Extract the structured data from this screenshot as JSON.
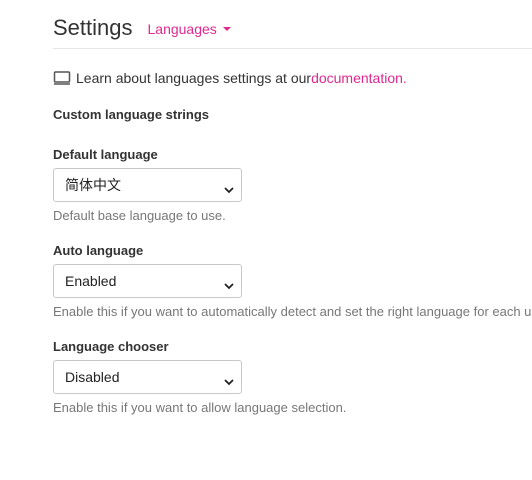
{
  "header": {
    "title": "Settings",
    "section_menu_label": "Languages"
  },
  "intro": {
    "text": "Learn about languages settings at our ",
    "link_label": "documentation",
    "suffix": "."
  },
  "section_heading": "Custom language strings",
  "fields": {
    "default_language": {
      "label": "Default language",
      "value": "简体中文",
      "help": "Default base language to use."
    },
    "auto_language": {
      "label": "Auto language",
      "value": "Enabled",
      "help": "Enable this if you want to automatically detect and set the right language for each u"
    },
    "language_chooser": {
      "label": "Language chooser",
      "value": "Disabled",
      "help": "Enable this if you want to allow language selection."
    }
  },
  "colors": {
    "accent": "#e0288f",
    "text": "#333333",
    "muted": "#777777",
    "border": "#c8c8c8"
  },
  "icons": {
    "documentation": "book-icon",
    "menu_caret": "caret-down-icon",
    "select_chevron": "chevron-down-icon"
  }
}
